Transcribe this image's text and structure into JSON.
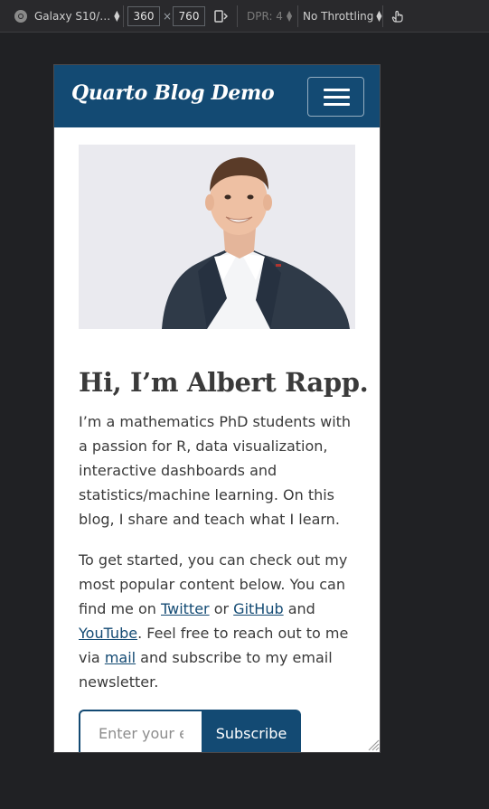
{
  "devtools": {
    "device": "Galaxy S10/…",
    "width": "360",
    "times": "×",
    "height": "760",
    "dpr": "DPR: 4",
    "throttling": "No Throttling"
  },
  "site": {
    "brand": "Quarto Blog Demo",
    "colors": {
      "primary": "#134a73",
      "text": "#3a3a3a"
    },
    "hero": {
      "title": "Hi, I’m Albert Rapp.",
      "intro": "I’m a mathematics PhD students with a passion for R, data visualization, interactive dashboards and statistics/machine learning. On this blog, I share and teach what I learn.",
      "p2_a": "To get started, you can check out my most popular content below. You can find me on ",
      "link_twitter": "Twitter",
      "p2_b": " or ",
      "link_github": "GitHub",
      "p2_c": " and ",
      "link_youtube": "YouTube",
      "p2_d": ". Feel free to reach out to me via ",
      "link_mail": "mail",
      "p2_e": " and subscribe to my email newsletter."
    },
    "newsletter": {
      "placeholder": "Enter your email",
      "button": "Subscribe"
    }
  }
}
